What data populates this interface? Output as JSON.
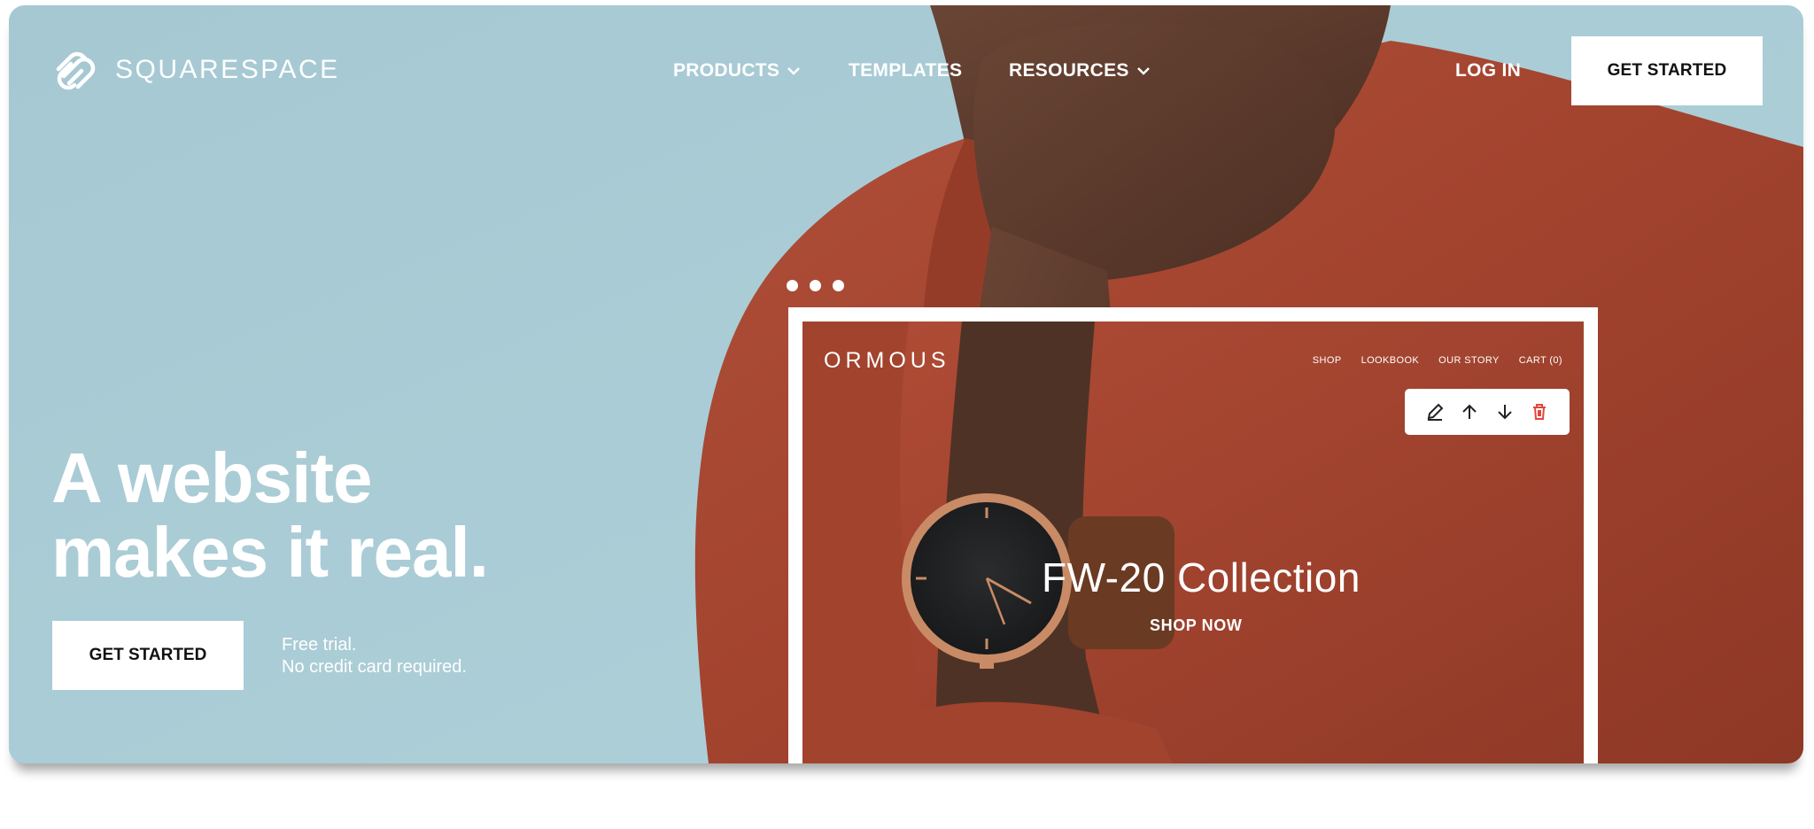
{
  "brand": {
    "name": "SQUARESPACE",
    "logo_icon": "squarespace-logo-icon"
  },
  "nav": {
    "products": "PRODUCTS",
    "templates": "TEMPLATES",
    "resources": "RESOURCES",
    "login": "LOG IN",
    "get_started": "GET STARTED"
  },
  "hero": {
    "headline_line1": "A website",
    "headline_line2": "makes it real.",
    "cta": "GET STARTED",
    "note_line1": "Free trial.",
    "note_line2": "No credit card required."
  },
  "slides": {
    "count": 3
  },
  "preview": {
    "site_name": "ORMOUS",
    "site_nav": [
      "SHOP",
      "LOOKBOOK",
      "OUR STORY",
      "CART (0)"
    ],
    "toolbar_icons": [
      "edit-pencil-icon",
      "move-up-arrow-icon",
      "move-down-arrow-icon",
      "delete-trash-icon"
    ],
    "collection_title": "FW-20 Collection",
    "shop_now": "SHOP NOW"
  },
  "colors": {
    "sky": "#a9ccd6",
    "garment": "#a8452f",
    "skin": "#5a3a2c",
    "delete_icon": "#e0473c"
  }
}
